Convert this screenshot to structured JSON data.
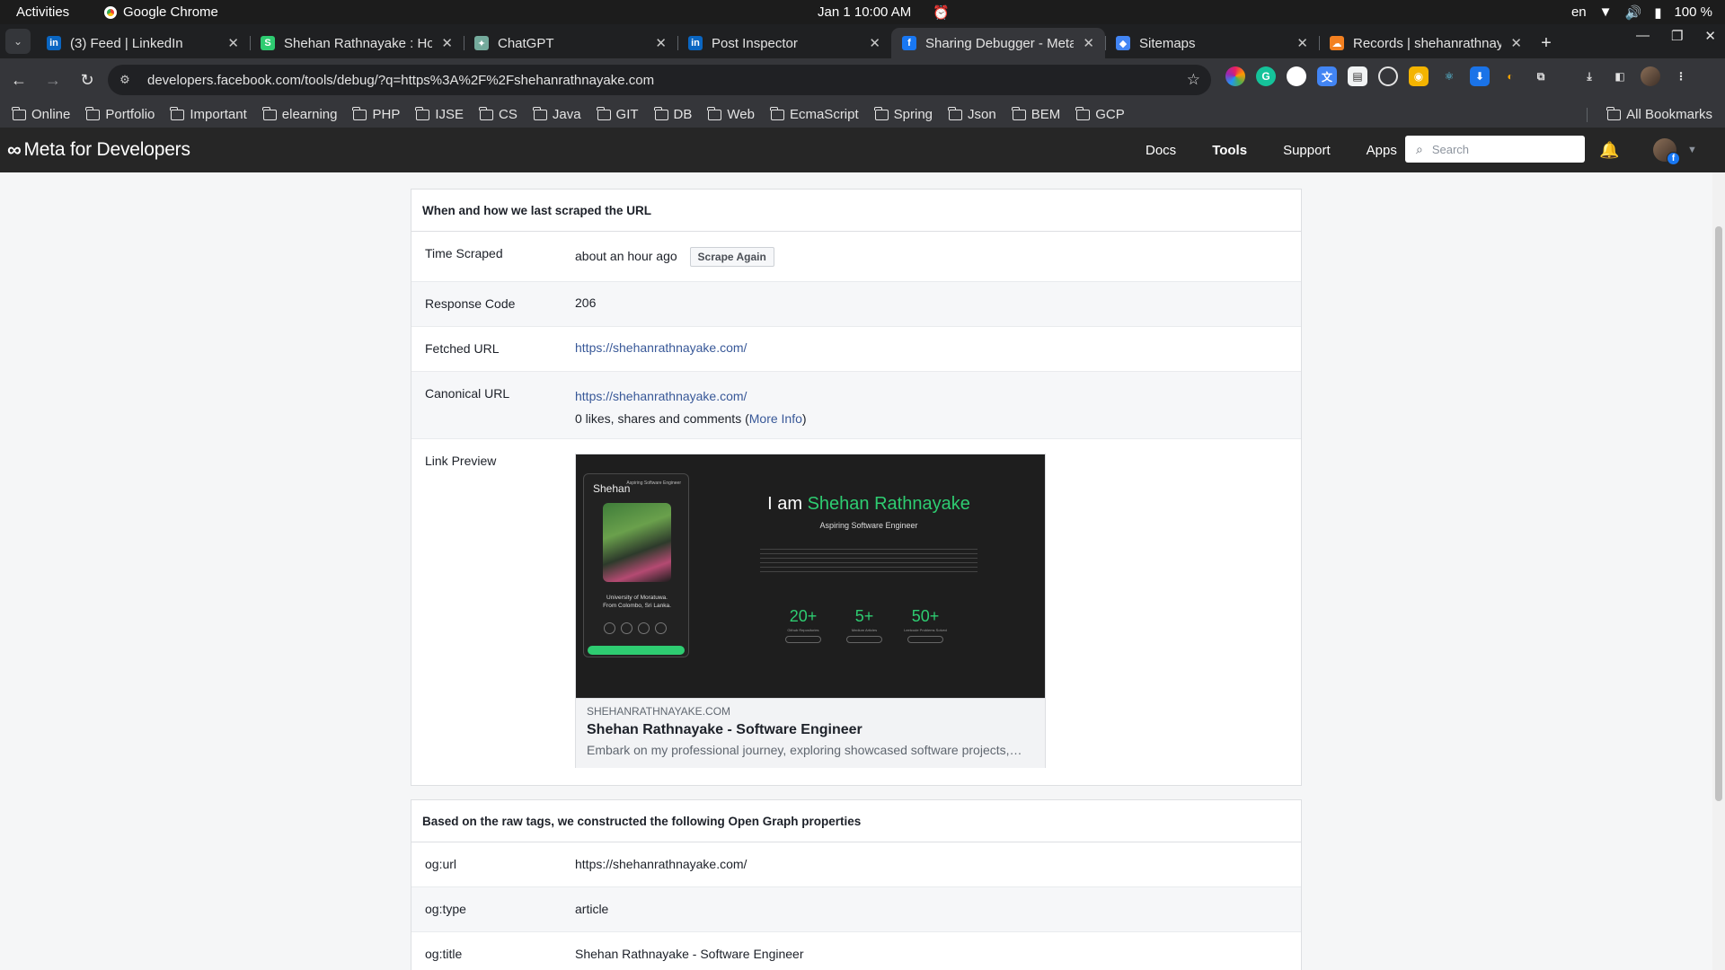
{
  "os": {
    "activities": "Activities",
    "app_name": "Google Chrome",
    "clock": "Jan 1  10:00 AM",
    "lang": "en",
    "battery": "100 %"
  },
  "tabs": [
    {
      "title": "(3) Feed | LinkedIn",
      "fav_color": "#0a66c2",
      "fav": "in",
      "active": false
    },
    {
      "title": "Shehan Rathnayake : Hom",
      "fav_color": "#2ecc71",
      "fav": "S",
      "active": false
    },
    {
      "title": "ChatGPT",
      "fav_color": "#74aa9c",
      "fav": "✦",
      "active": false
    },
    {
      "title": "Post Inspector",
      "fav_color": "#0a66c2",
      "fav": "in",
      "active": false
    },
    {
      "title": "Sharing Debugger - Meta",
      "fav_color": "#1877f2",
      "fav": "f",
      "active": true
    },
    {
      "title": "Sitemaps",
      "fav_color": "#4285f4",
      "fav": "◆",
      "active": false
    },
    {
      "title": "Records | shehanrathnaya",
      "fav_color": "#f38020",
      "fav": "☁",
      "active": false
    }
  ],
  "toolbar": {
    "url": "developers.facebook.com/tools/debug/?q=https%3A%2F%2Fshehanrathnayake.com"
  },
  "bookmarks": [
    "Online",
    "Portfolio",
    "Important",
    "elearning",
    "PHP",
    "IJSE",
    "CS",
    "Java",
    "GIT",
    "DB",
    "Web",
    "EcmaScript",
    "Spring",
    "Json",
    "BEM",
    "GCP"
  ],
  "all_bookmarks": "All Bookmarks",
  "meta": {
    "logo": "Meta for Developers",
    "nav": [
      "Docs",
      "Tools",
      "Support",
      "Apps"
    ],
    "search_placeholder": "Search"
  },
  "scrape_card": {
    "heading": "When and how we last scraped the URL",
    "time_label": "Time Scraped",
    "time_value": "about an hour ago",
    "scrape_button": "Scrape Again",
    "response_label": "Response Code",
    "response_value": "206",
    "fetched_label": "Fetched URL",
    "fetched_value": "https://shehanrathnayake.com/",
    "canonical_label": "Canonical URL",
    "canonical_value": "https://shehanrathnayake.com/",
    "likes_prefix": "0 likes, shares and comments (",
    "more_info": "More Info",
    "likes_suffix": ")",
    "preview_label": "Link Preview"
  },
  "preview": {
    "card_name": "Shehan",
    "card_sub": "Aspiring Software Engineer",
    "card_uni": "University of Moratuwa.",
    "card_loc": "From Colombo, Sri Lanka.",
    "hero_prefix": "I am ",
    "hero_name": "Shehan Rathnayake",
    "hero_sub": "Aspiring Software Engineer",
    "stats": [
      {
        "n": "20+",
        "t": "Github Repositories"
      },
      {
        "n": "5+",
        "t": "Medium Articles"
      },
      {
        "n": "50+",
        "t": "Leetcode Problems Solved"
      }
    ],
    "domain": "SHEHANRATHNAYAKE.COM",
    "title": "Shehan Rathnayake - Software Engineer",
    "description": "Embark on my professional journey, exploring showcased software projects,…"
  },
  "og_card": {
    "heading": "Based on the raw tags, we constructed the following Open Graph properties",
    "rows": [
      {
        "label": "og:url",
        "value": "https://shehanrathnayake.com/"
      },
      {
        "label": "og:type",
        "value": "article"
      },
      {
        "label": "og:title",
        "value": "Shehan Rathnayake - Software Engineer"
      }
    ]
  }
}
